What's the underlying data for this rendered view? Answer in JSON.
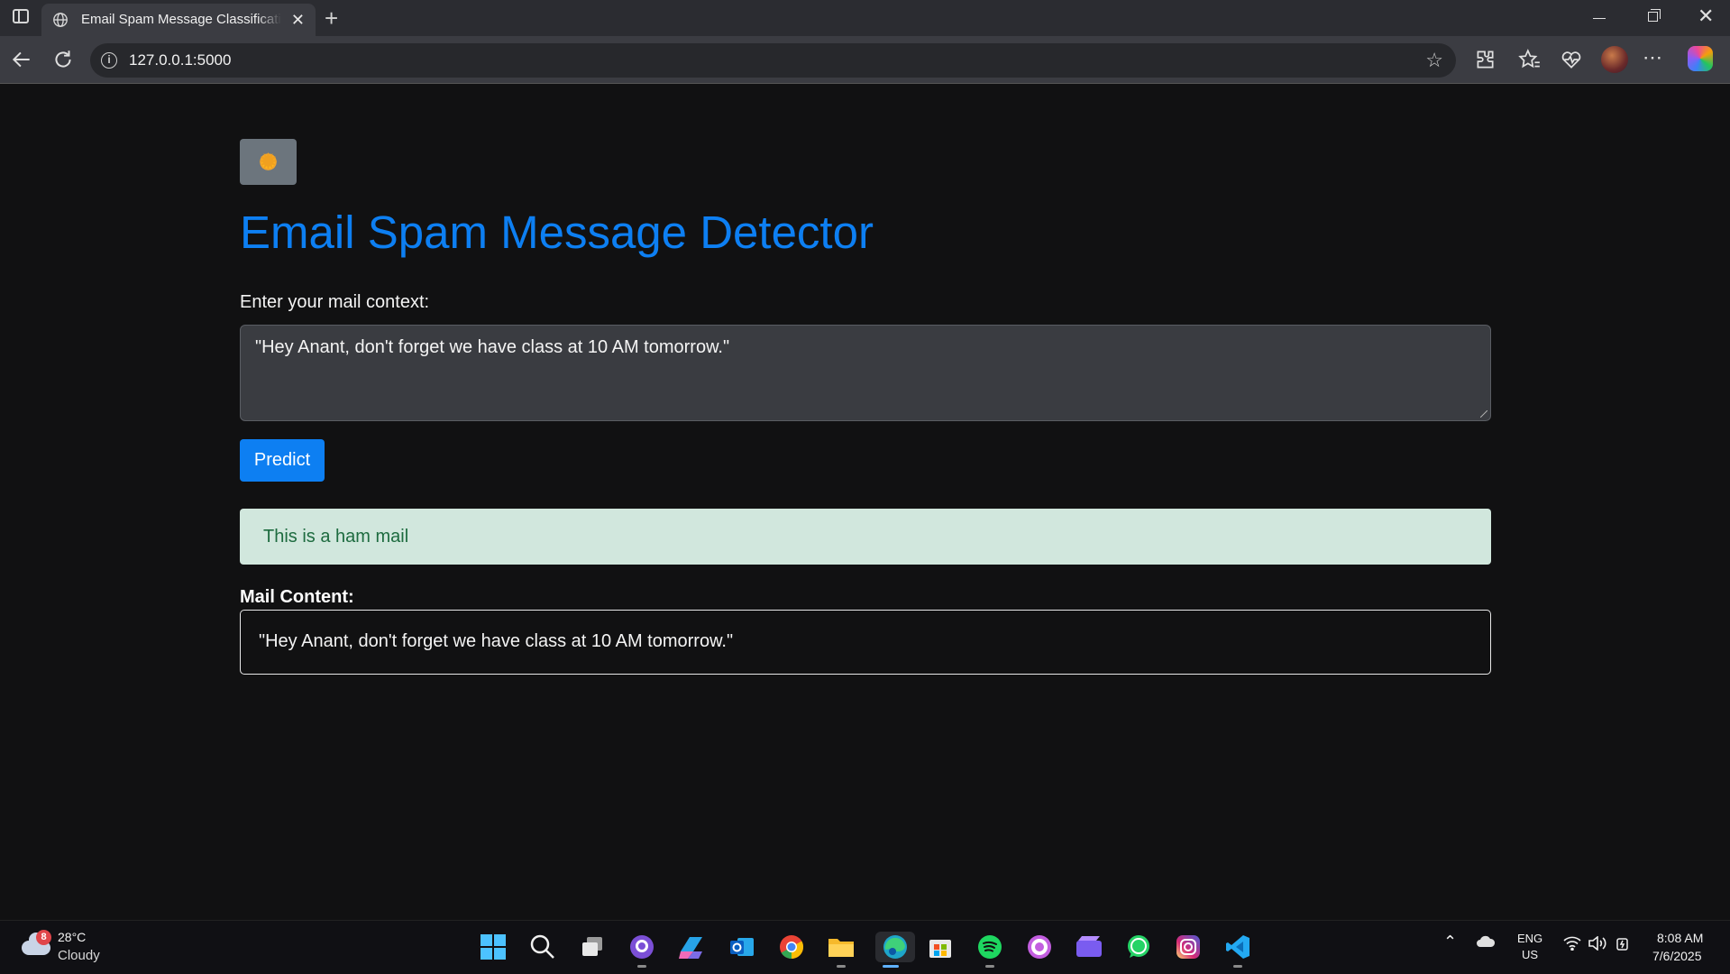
{
  "browser": {
    "tab_title": "Email Spam Message Classification",
    "tab_close": "✕",
    "new_tab": "+",
    "url": "127.0.0.1:5000",
    "window_close": "✕"
  },
  "page": {
    "theme_toggle_icon": "sun-icon",
    "title": "Email Spam Message Detector",
    "input_label": "Enter your mail context:",
    "input_value": "\"Hey Anant, don't forget we have class at 10 AM tomorrow.\"",
    "predict_label": "Predict",
    "result_text": "This is a ham mail",
    "content_label": "Mail Content:",
    "content_text": "\"Hey Anant, don't forget we have class at 10 AM tomorrow.\"",
    "colors": {
      "accent": "#0d7ff2",
      "result_bg": "#d1e7dd",
      "result_text": "#1d6b3f",
      "background": "#111112"
    }
  },
  "taskbar": {
    "weather_badge": "8",
    "temperature": "28°C",
    "condition": "Cloudy",
    "apps": [
      "windows-start-icon",
      "search-icon",
      "task-view-icon",
      "github-desktop-icon",
      "microsoft-365-icon",
      "outlook-icon",
      "chrome-icon",
      "file-explorer-icon",
      "edge-icon",
      "microsoft-store-icon",
      "spotify-icon",
      "obs-icon",
      "clipchamp-icon",
      "whatsapp-icon",
      "instagram-icon",
      "vscode-icon"
    ],
    "language_line1": "ENG",
    "language_line2": "US",
    "time": "8:08 AM",
    "date": "7/6/2025"
  }
}
